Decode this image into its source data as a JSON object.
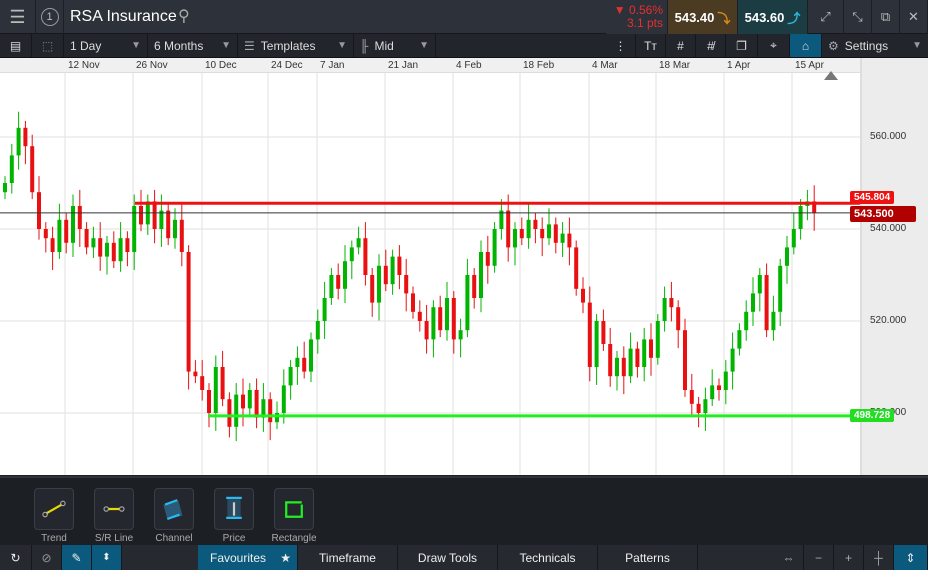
{
  "header": {
    "title": "RSA Insurance",
    "layout_number": "1",
    "change_pct": "▼ 0.56%",
    "change_pts": "3.1 pts",
    "bid": "543.40",
    "ask": "543.60"
  },
  "toolbar": {
    "interval": "1 Day",
    "range": "6 Months",
    "templates": "Templates",
    "price_type": "Mid",
    "settings": "Settings"
  },
  "date_labels": [
    "12 Nov",
    "26 Nov",
    "10 Dec",
    "24 Dec",
    "7 Jan",
    "21 Jan",
    "4 Feb",
    "18 Feb",
    "4 Mar",
    "18 Mar",
    "1 Apr",
    "15 Apr"
  ],
  "draw_tools": [
    "Trend",
    "S/R Line",
    "Channel",
    "Price",
    "Rectangle"
  ],
  "bottom_tabs": [
    "Favourites",
    "Timeframe",
    "Draw Tools",
    "Technicals",
    "Patterns"
  ],
  "colors": {
    "up": "#00b400",
    "down": "#e81010",
    "accent": "#0b5a7e"
  },
  "chart_data": {
    "type": "candlestick",
    "ylim": [
      474,
      570
    ],
    "y_ticks": [
      "560.000",
      "540.000",
      "520.000",
      "500.000"
    ],
    "resistance_line": "545.804",
    "current_price": "543.500",
    "support_line": "498.728",
    "closes": [
      550,
      556,
      562,
      558,
      548,
      540,
      538,
      535,
      542,
      537,
      545,
      540,
      536,
      538,
      534,
      537,
      533,
      538,
      535,
      545,
      541,
      546,
      540,
      544,
      538,
      542,
      535,
      509,
      508,
      505,
      500,
      510,
      503,
      497,
      504,
      501,
      505,
      499,
      503,
      498,
      500,
      506,
      510,
      512,
      509,
      516,
      520,
      525,
      530,
      527,
      533,
      536,
      538,
      530,
      524,
      532,
      528,
      534,
      530,
      526,
      522,
      520,
      516,
      523,
      518,
      525,
      516,
      518,
      530,
      525,
      535,
      532,
      540,
      544,
      536,
      540,
      538,
      542,
      540,
      538,
      541,
      537,
      539,
      536,
      527,
      524,
      510,
      520,
      515,
      508,
      512,
      508,
      514,
      510,
      516,
      512,
      520,
      525,
      523,
      518,
      505,
      502,
      500,
      503,
      506,
      505,
      509,
      514,
      518,
      522,
      526,
      530,
      518,
      522,
      532,
      536,
      540,
      545,
      546,
      543.5
    ]
  }
}
